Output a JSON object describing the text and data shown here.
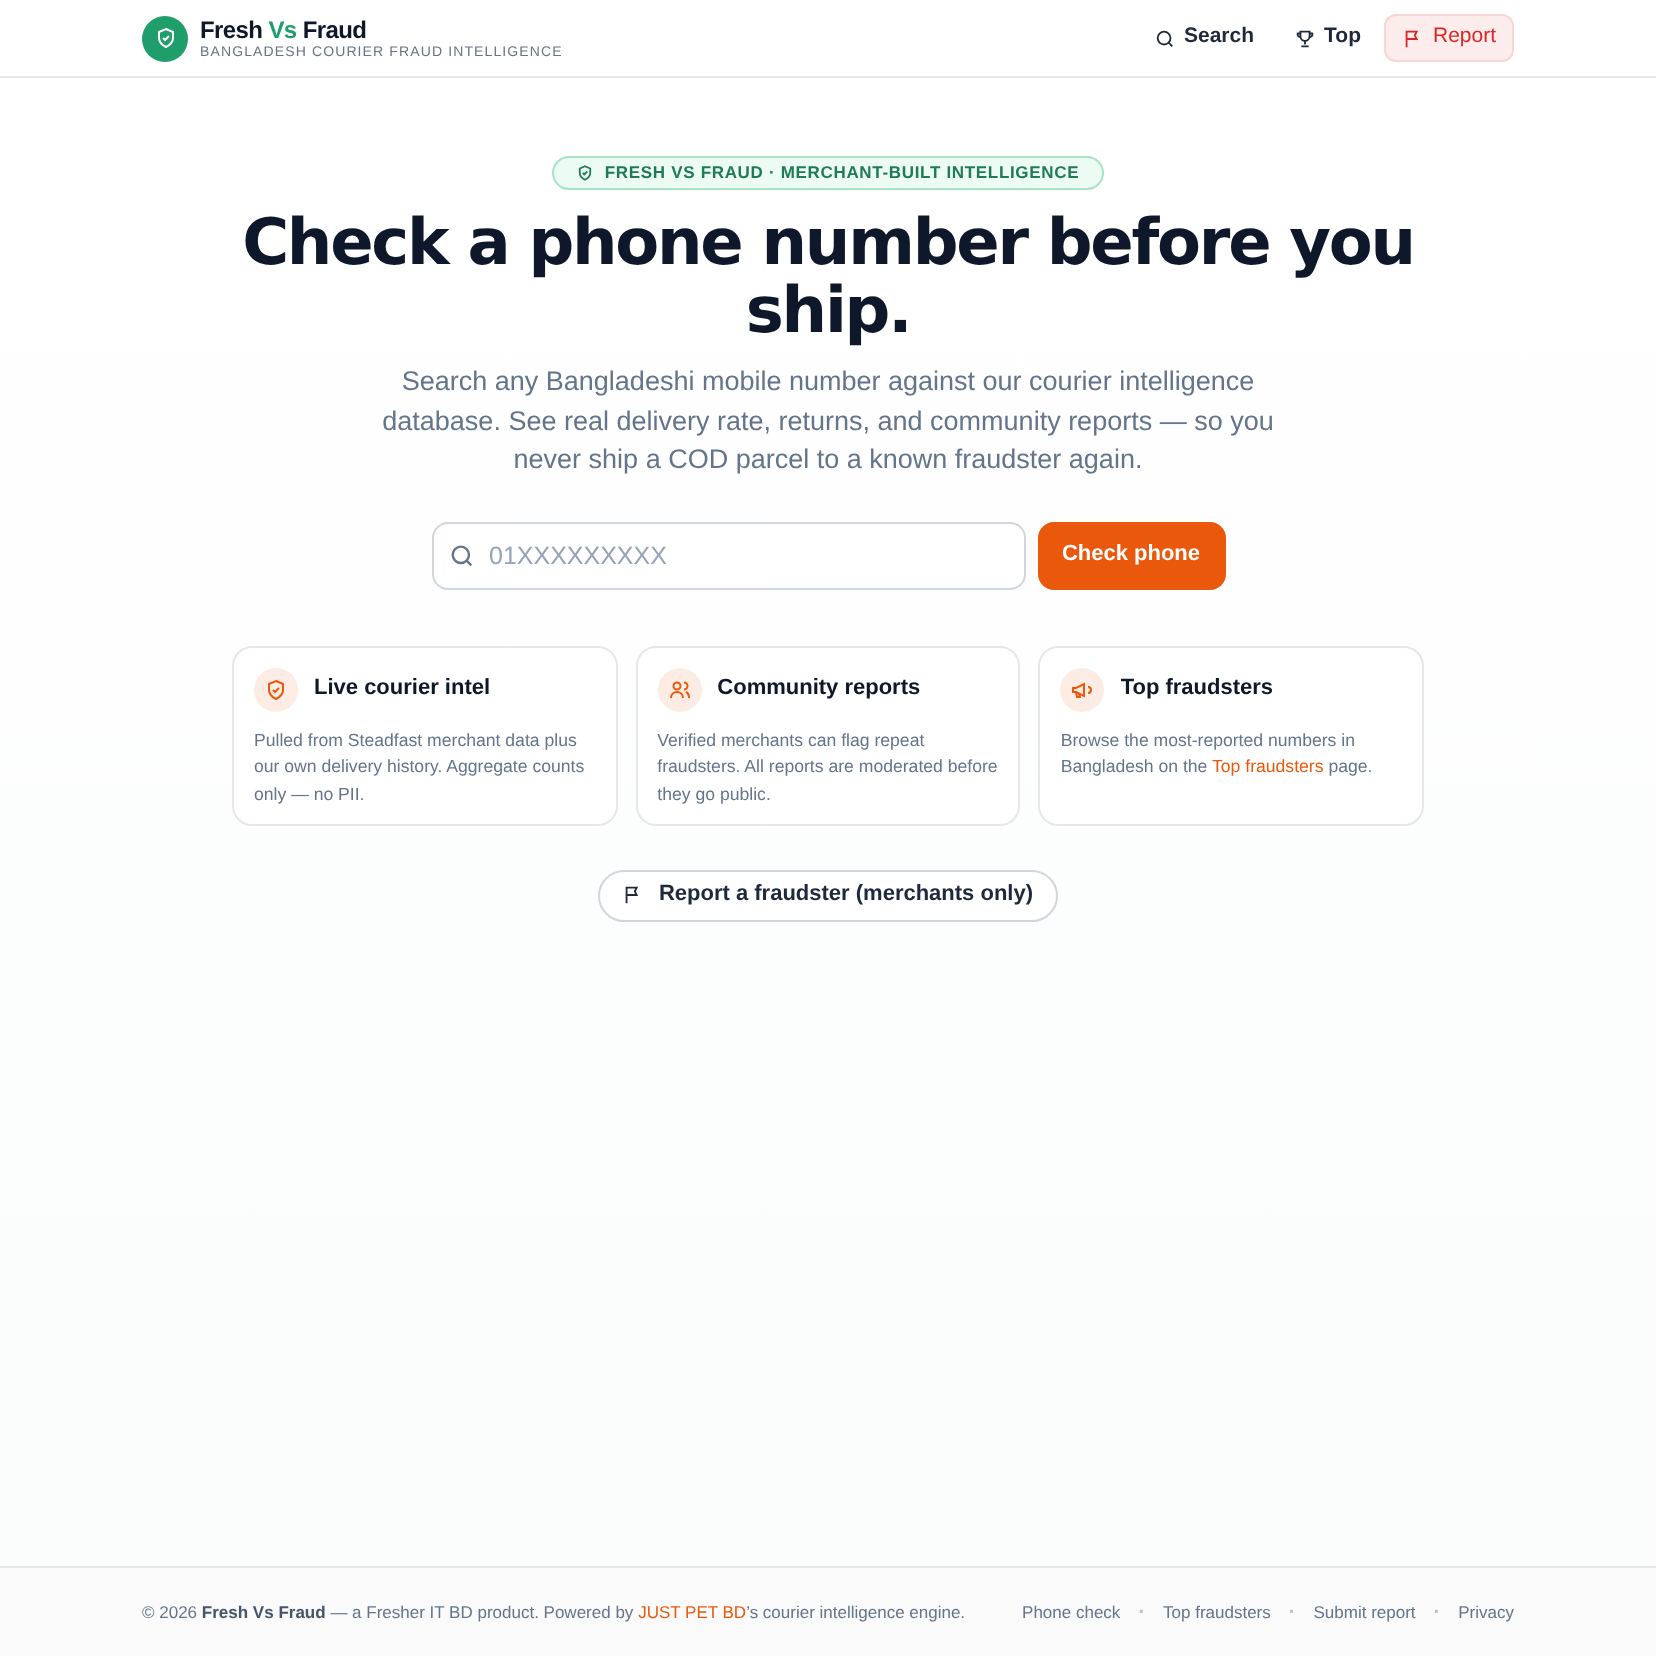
{
  "header": {
    "brand": {
      "before": "Fresh",
      "accent": "Vs",
      "after": "Fraud"
    },
    "tagline": "BANGLADESH COURIER FRAUD INTELLIGENCE",
    "nav": [
      {
        "kind": "search",
        "label": "Search",
        "selected": false
      },
      {
        "kind": "trophy",
        "label": "Top",
        "selected": false
      },
      {
        "kind": "flag",
        "label": "Report",
        "selected": true
      }
    ]
  },
  "hero": {
    "badge": "FRESH VS FRAUD · MERCHANT-BUILT INTELLIGENCE",
    "title": "Check a phone number before you ship.",
    "subtitle": "Search any Bangladeshi mobile number against our courier intelligence database. See real delivery rate, returns, and community reports — so you never ship a COD parcel to a known fraudster again.",
    "search": {
      "placeholder": "01XXXXXXXXX",
      "button": "Check phone"
    }
  },
  "cards": [
    {
      "kind": "shield",
      "title": "Live courier intel",
      "text": "Pulled from Steadfast merchant data plus our own delivery history. Aggregate counts only — no PII."
    },
    {
      "kind": "users",
      "title": "Community reports",
      "text": "Verified merchants can flag repeat fraudsters. All reports are moderated before they go public."
    },
    {
      "kind": "megaphone",
      "title": "Top fraudsters",
      "text": "Browse the most-reported numbers in Bangladesh on the",
      "link": "Top fraudsters",
      "text_after": "page."
    }
  ],
  "report_button": "Report a fraudster (merchants only)",
  "footer": {
    "before": "© 2026",
    "brand": "Fresh Vs Fraud",
    "middle": "— a Fresher IT BD product. Powered by",
    "link": "JUST PET BD",
    "after": "’s courier intelligence engine.",
    "items": [
      {
        "kind": "link",
        "text": "Phone check"
      },
      {
        "kind": "separator",
        "text": "·"
      },
      {
        "kind": "link",
        "text": "Top fraudsters"
      },
      {
        "kind": "separator",
        "text": "·"
      },
      {
        "kind": "link",
        "text": "Submit report"
      },
      {
        "kind": "separator",
        "text": "·"
      },
      {
        "kind": "link",
        "text": "Privacy"
      }
    ]
  }
}
